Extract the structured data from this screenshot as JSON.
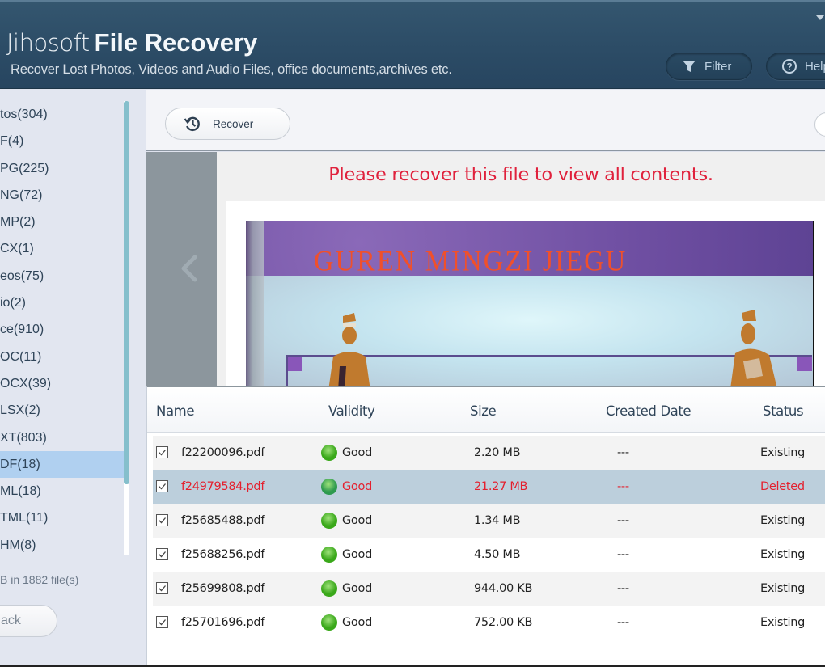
{
  "header": {
    "brand": "Jihosoft",
    "product": "File Recovery",
    "subtitle": "Recover Lost Photos, Videos and Audio Files, office documents,archives etc.",
    "filter_label": "Filter",
    "help_label": "Help",
    "filter_icon": "funnel-icon",
    "help_icon": "question-circle-icon",
    "menu_icon": "dropdown-arrow-icon"
  },
  "sidebar": {
    "items": [
      {
        "label": "tos(304)",
        "selected": false
      },
      {
        "label": "F(4)",
        "selected": false
      },
      {
        "label": "PG(225)",
        "selected": false
      },
      {
        "label": "NG(72)",
        "selected": false
      },
      {
        "label": "MP(2)",
        "selected": false
      },
      {
        "label": "CX(1)",
        "selected": false
      },
      {
        "label": "eos(75)",
        "selected": false
      },
      {
        "label": "io(2)",
        "selected": false
      },
      {
        "label": "ce(910)",
        "selected": false
      },
      {
        "label": "OC(11)",
        "selected": false
      },
      {
        "label": "OCX(39)",
        "selected": false
      },
      {
        "label": "LSX(2)",
        "selected": false
      },
      {
        "label": "XT(803)",
        "selected": false
      },
      {
        "label": "DF(18)",
        "selected": true
      },
      {
        "label": "ML(18)",
        "selected": false
      },
      {
        "label": "TML(11)",
        "selected": false
      },
      {
        "label": "HM(8)",
        "selected": false
      }
    ],
    "summary": "B in 1882 file(s)",
    "back_label": "ack"
  },
  "toolbar": {
    "recover_label": "Recover",
    "recover_icon": "history-icon"
  },
  "preview": {
    "message": "Please recover this file to view all contents.",
    "cover_title": "GUREN MINGZI JIEGU",
    "prev_icon": "chevron-left-icon"
  },
  "table": {
    "columns": [
      "Name",
      "Validity",
      "Size",
      "Created Date",
      "Status"
    ],
    "rows": [
      {
        "checked": true,
        "name": "f22200096.pdf",
        "validity": "Good",
        "size": "2.20 MB",
        "date": "---",
        "status": "Existing",
        "selected": false
      },
      {
        "checked": true,
        "name": "f24979584.pdf",
        "validity": "Good",
        "size": "21.27 MB",
        "date": "---",
        "status": "Deleted",
        "selected": true
      },
      {
        "checked": true,
        "name": "f25685488.pdf",
        "validity": "Good",
        "size": "1.34 MB",
        "date": "---",
        "status": "Existing",
        "selected": false
      },
      {
        "checked": true,
        "name": "f25688256.pdf",
        "validity": "Good",
        "size": "4.50 MB",
        "date": "---",
        "status": "Existing",
        "selected": false
      },
      {
        "checked": true,
        "name": "f25699808.pdf",
        "validity": "Good",
        "size": "944.00 KB",
        "date": "---",
        "status": "Existing",
        "selected": false
      },
      {
        "checked": true,
        "name": "f25701696.pdf",
        "validity": "Good",
        "size": "752.00 KB",
        "date": "---",
        "status": "Existing",
        "selected": false
      }
    ]
  },
  "colors": {
    "header_bg": "#2c4c66",
    "accent_red": "#e0213c",
    "selected_row": "#bccfdc",
    "selected_sidebar": "#b0d0f0",
    "good_dot": "#3aa81a",
    "good_dot_selected": "#2e9a4e"
  }
}
